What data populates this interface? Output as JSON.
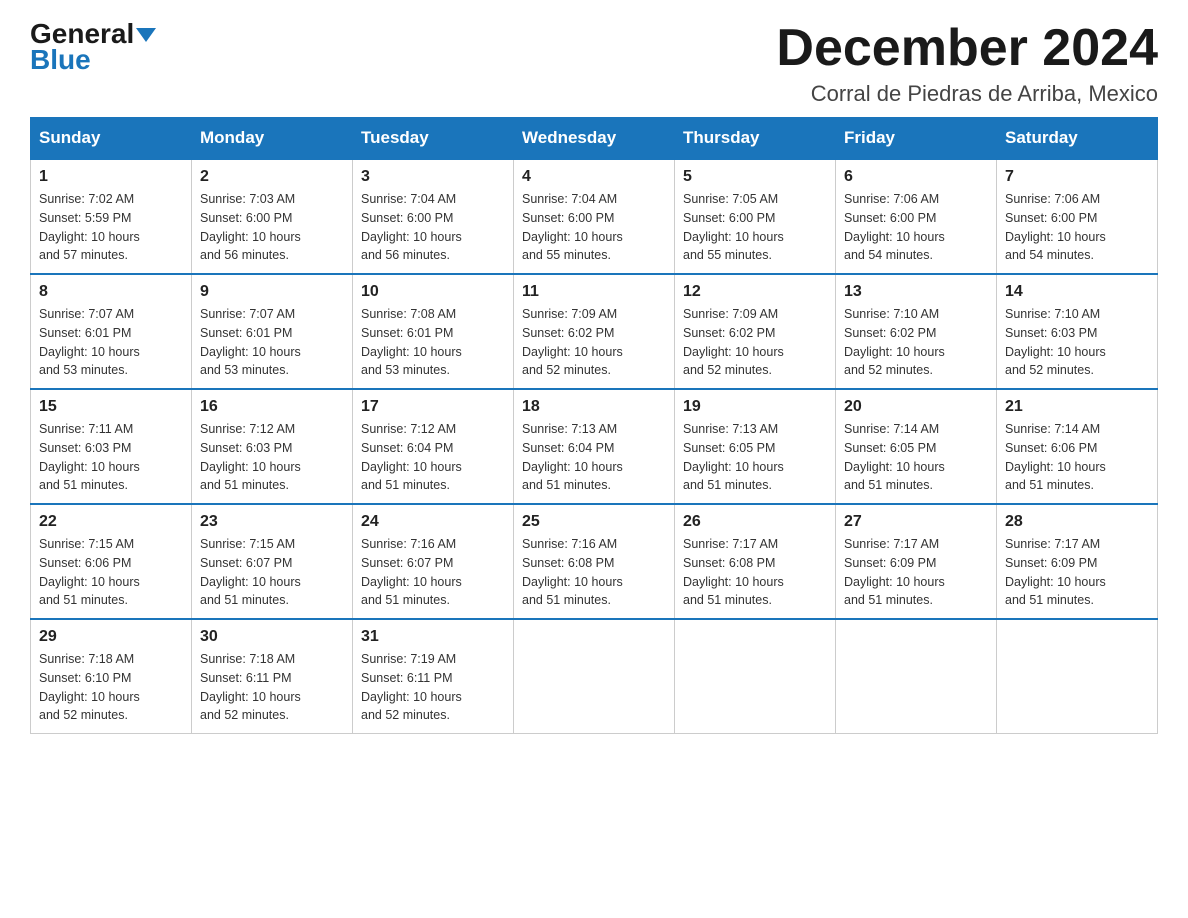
{
  "header": {
    "logo_general": "General",
    "logo_blue": "Blue",
    "month_title": "December 2024",
    "location": "Corral de Piedras de Arriba, Mexico"
  },
  "days_of_week": [
    "Sunday",
    "Monday",
    "Tuesday",
    "Wednesday",
    "Thursday",
    "Friday",
    "Saturday"
  ],
  "weeks": [
    [
      {
        "day": "1",
        "sunrise": "7:02 AM",
        "sunset": "5:59 PM",
        "daylight": "10 hours and 57 minutes."
      },
      {
        "day": "2",
        "sunrise": "7:03 AM",
        "sunset": "6:00 PM",
        "daylight": "10 hours and 56 minutes."
      },
      {
        "day": "3",
        "sunrise": "7:04 AM",
        "sunset": "6:00 PM",
        "daylight": "10 hours and 56 minutes."
      },
      {
        "day": "4",
        "sunrise": "7:04 AM",
        "sunset": "6:00 PM",
        "daylight": "10 hours and 55 minutes."
      },
      {
        "day": "5",
        "sunrise": "7:05 AM",
        "sunset": "6:00 PM",
        "daylight": "10 hours and 55 minutes."
      },
      {
        "day": "6",
        "sunrise": "7:06 AM",
        "sunset": "6:00 PM",
        "daylight": "10 hours and 54 minutes."
      },
      {
        "day": "7",
        "sunrise": "7:06 AM",
        "sunset": "6:00 PM",
        "daylight": "10 hours and 54 minutes."
      }
    ],
    [
      {
        "day": "8",
        "sunrise": "7:07 AM",
        "sunset": "6:01 PM",
        "daylight": "10 hours and 53 minutes."
      },
      {
        "day": "9",
        "sunrise": "7:07 AM",
        "sunset": "6:01 PM",
        "daylight": "10 hours and 53 minutes."
      },
      {
        "day": "10",
        "sunrise": "7:08 AM",
        "sunset": "6:01 PM",
        "daylight": "10 hours and 53 minutes."
      },
      {
        "day": "11",
        "sunrise": "7:09 AM",
        "sunset": "6:02 PM",
        "daylight": "10 hours and 52 minutes."
      },
      {
        "day": "12",
        "sunrise": "7:09 AM",
        "sunset": "6:02 PM",
        "daylight": "10 hours and 52 minutes."
      },
      {
        "day": "13",
        "sunrise": "7:10 AM",
        "sunset": "6:02 PM",
        "daylight": "10 hours and 52 minutes."
      },
      {
        "day": "14",
        "sunrise": "7:10 AM",
        "sunset": "6:03 PM",
        "daylight": "10 hours and 52 minutes."
      }
    ],
    [
      {
        "day": "15",
        "sunrise": "7:11 AM",
        "sunset": "6:03 PM",
        "daylight": "10 hours and 51 minutes."
      },
      {
        "day": "16",
        "sunrise": "7:12 AM",
        "sunset": "6:03 PM",
        "daylight": "10 hours and 51 minutes."
      },
      {
        "day": "17",
        "sunrise": "7:12 AM",
        "sunset": "6:04 PM",
        "daylight": "10 hours and 51 minutes."
      },
      {
        "day": "18",
        "sunrise": "7:13 AM",
        "sunset": "6:04 PM",
        "daylight": "10 hours and 51 minutes."
      },
      {
        "day": "19",
        "sunrise": "7:13 AM",
        "sunset": "6:05 PM",
        "daylight": "10 hours and 51 minutes."
      },
      {
        "day": "20",
        "sunrise": "7:14 AM",
        "sunset": "6:05 PM",
        "daylight": "10 hours and 51 minutes."
      },
      {
        "day": "21",
        "sunrise": "7:14 AM",
        "sunset": "6:06 PM",
        "daylight": "10 hours and 51 minutes."
      }
    ],
    [
      {
        "day": "22",
        "sunrise": "7:15 AM",
        "sunset": "6:06 PM",
        "daylight": "10 hours and 51 minutes."
      },
      {
        "day": "23",
        "sunrise": "7:15 AM",
        "sunset": "6:07 PM",
        "daylight": "10 hours and 51 minutes."
      },
      {
        "day": "24",
        "sunrise": "7:16 AM",
        "sunset": "6:07 PM",
        "daylight": "10 hours and 51 minutes."
      },
      {
        "day": "25",
        "sunrise": "7:16 AM",
        "sunset": "6:08 PM",
        "daylight": "10 hours and 51 minutes."
      },
      {
        "day": "26",
        "sunrise": "7:17 AM",
        "sunset": "6:08 PM",
        "daylight": "10 hours and 51 minutes."
      },
      {
        "day": "27",
        "sunrise": "7:17 AM",
        "sunset": "6:09 PM",
        "daylight": "10 hours and 51 minutes."
      },
      {
        "day": "28",
        "sunrise": "7:17 AM",
        "sunset": "6:09 PM",
        "daylight": "10 hours and 51 minutes."
      }
    ],
    [
      {
        "day": "29",
        "sunrise": "7:18 AM",
        "sunset": "6:10 PM",
        "daylight": "10 hours and 52 minutes."
      },
      {
        "day": "30",
        "sunrise": "7:18 AM",
        "sunset": "6:11 PM",
        "daylight": "10 hours and 52 minutes."
      },
      {
        "day": "31",
        "sunrise": "7:19 AM",
        "sunset": "6:11 PM",
        "daylight": "10 hours and 52 minutes."
      },
      null,
      null,
      null,
      null
    ]
  ],
  "labels": {
    "sunrise": "Sunrise:",
    "sunset": "Sunset:",
    "daylight": "Daylight:"
  }
}
